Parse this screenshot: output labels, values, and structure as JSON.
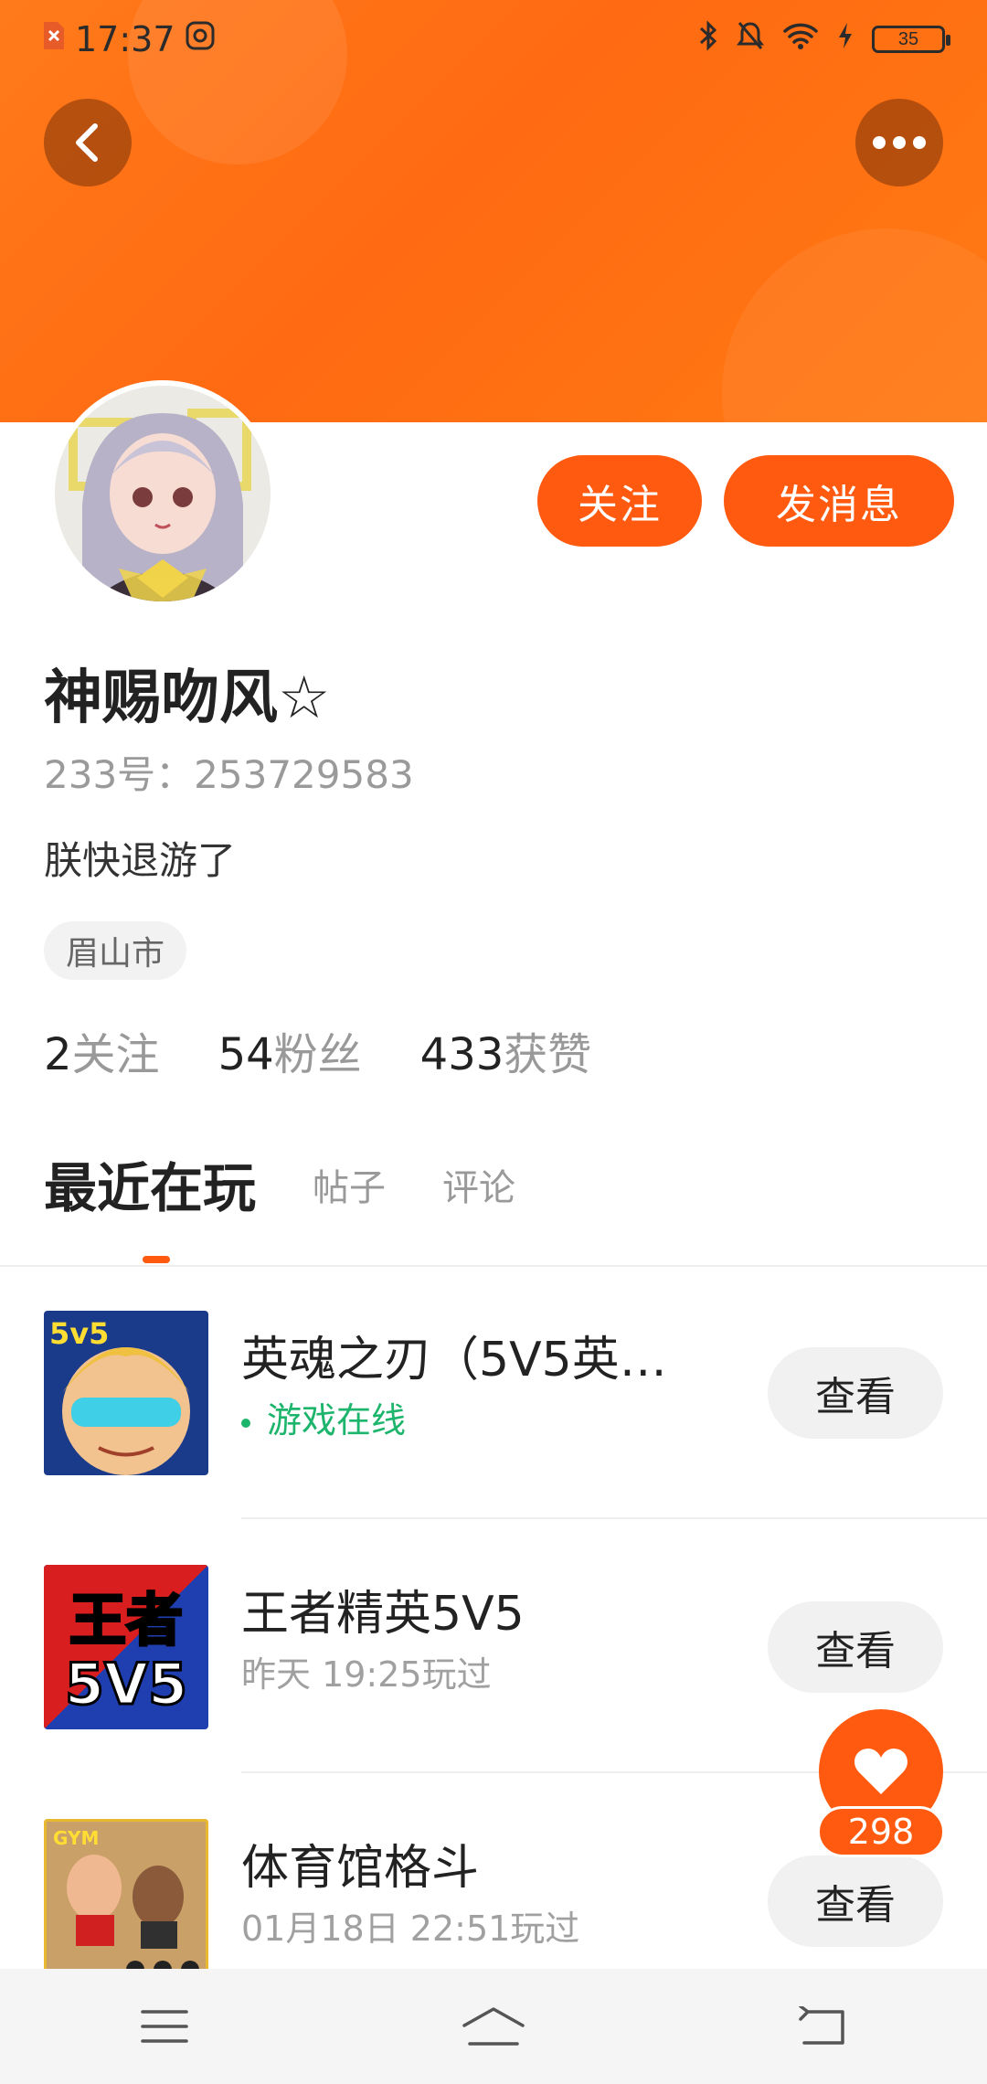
{
  "status_bar": {
    "time": "17:37",
    "battery": "35"
  },
  "profile": {
    "name": "神赐吻风☆",
    "uid": "233号：253729583",
    "bio": "朕快退游了",
    "location": "眉山市",
    "follow_label": "关注",
    "message_label": "发消息",
    "stats": [
      {
        "num": "2",
        "label": "关注"
      },
      {
        "num": "54",
        "label": "粉丝"
      },
      {
        "num": "433",
        "label": "获赞"
      }
    ]
  },
  "tabs": [
    {
      "label": "最近在玩",
      "active": true
    },
    {
      "label": "帖子",
      "active": false
    },
    {
      "label": "评论",
      "active": false
    }
  ],
  "games": [
    {
      "title": "英魂之刃（5V5英…",
      "subtitle": "游戏在线",
      "online": true,
      "button": "查看",
      "icon_text": "5v5"
    },
    {
      "title": "王者精英5V5",
      "subtitle": "昨天 19:25玩过",
      "online": false,
      "button": "查看",
      "icon_text": "王者 5V5"
    },
    {
      "title": "体育馆格斗",
      "subtitle": "01月18日 22:51玩过",
      "online": false,
      "button": "查看",
      "icon_text": "GYM FIGHT"
    }
  ],
  "like": {
    "count": "298"
  },
  "colors": {
    "accent": "#ff5a0f",
    "header": "#ff7a1a",
    "online": "#1db46c"
  }
}
